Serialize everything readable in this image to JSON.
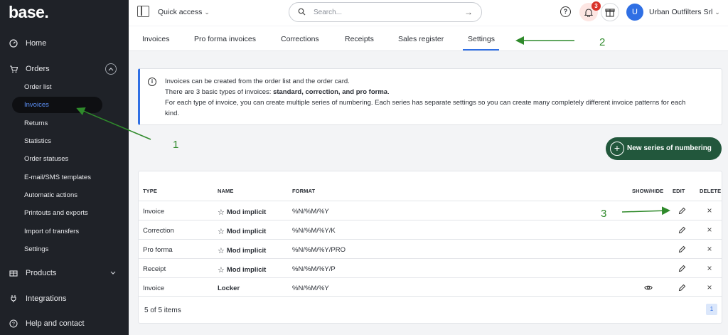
{
  "sidebar": {
    "logo": "base.",
    "items": [
      {
        "label": "Home",
        "icon": "gauge-icon"
      },
      {
        "label": "Orders",
        "icon": "cart-icon"
      },
      {
        "label": "Products",
        "icon": "box-icon"
      },
      {
        "label": "Integrations",
        "icon": "plug-icon"
      },
      {
        "label": "Help and contact",
        "icon": "help-icon"
      }
    ],
    "orders_sub": [
      "Order list",
      "Invoices",
      "Returns",
      "Statistics",
      "Order statuses",
      "E-mail/SMS templates",
      "Automatic actions",
      "Printouts and exports",
      "Import of transfers",
      "Settings"
    ]
  },
  "topbar": {
    "quick_access": "Quick access",
    "search_placeholder": "Search...",
    "notifications_count": "3",
    "avatar_initial": "U",
    "company": "Urban Outfilters Srl"
  },
  "tabs": [
    "Invoices",
    "Pro forma invoices",
    "Corrections",
    "Receipts",
    "Sales register",
    "Settings"
  ],
  "active_tab": "Settings",
  "info": {
    "line1": "Invoices can be created from the order list and the order card.",
    "line2_pre": "There are 3 basic types of invoices: ",
    "line2_bold": "standard, correction, and pro forma",
    "line2_post": ".",
    "line3": "For each type of invoice, you can create multiple series of numbering. Each series has separate settings so you can create many completely different invoice patterns for each",
    "line4": "kind."
  },
  "new_series_label": "New series of numbering",
  "table": {
    "headers": {
      "type": "TYPE",
      "name": "NAME",
      "format": "FORMAT",
      "show_hide": "SHOW/HIDE",
      "edit": "EDIT",
      "delete": "DELETE"
    },
    "rows": [
      {
        "type": "Invoice",
        "name": "Mod implicit",
        "star": true,
        "format": "%N/%M/%Y",
        "show_hide": false
      },
      {
        "type": "Correction",
        "name": "Mod implicit",
        "star": true,
        "format": "%N/%M/%Y/K",
        "show_hide": false
      },
      {
        "type": "Pro forma",
        "name": "Mod implicit",
        "star": true,
        "format": "%N/%M/%Y/PRO",
        "show_hide": false
      },
      {
        "type": "Receipt",
        "name": "Mod implicit",
        "star": true,
        "format": "%N/%M/%Y/P",
        "show_hide": false
      },
      {
        "type": "Invoice",
        "name": "Locker",
        "star": false,
        "format": "%N/%M/%Y",
        "show_hide": true
      }
    ],
    "count_text": "5 of 5 items",
    "page": "1"
  },
  "annotations": [
    "1",
    "2",
    "3"
  ],
  "colors": {
    "accent": "#2f6fe4",
    "primary_button": "#22573c",
    "annotation": "#2f8a2b",
    "sidebar_bg": "#1f2228"
  }
}
